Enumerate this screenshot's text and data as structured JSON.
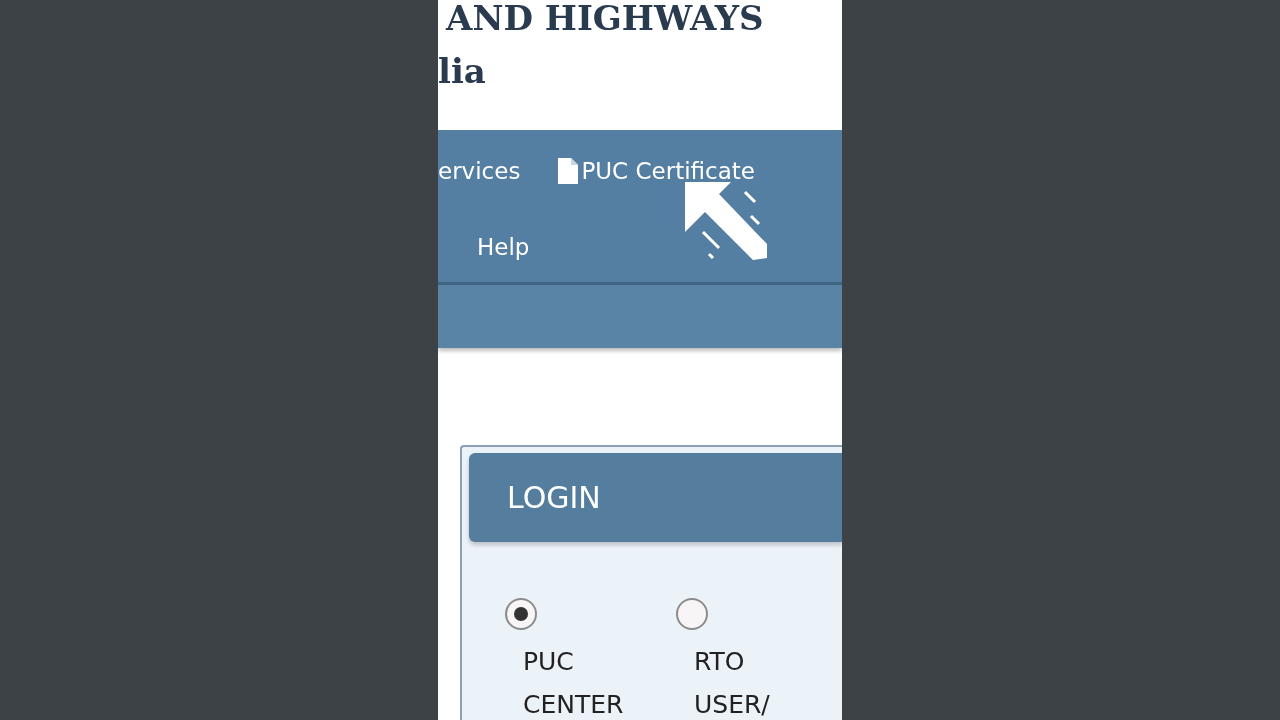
{
  "header": {
    "title_lines": [
      "AND HIGHWAYS",
      "lia"
    ]
  },
  "nav": {
    "rows": [
      [
        {
          "label": "ervices",
          "kind": "plain"
        },
        {
          "label": "PUC Certificate",
          "kind": "file"
        }
      ],
      [
        {
          "label": "Help",
          "kind": "plain"
        }
      ]
    ]
  },
  "login": {
    "title": "LOGIN",
    "options": [
      {
        "label": "PUC CENTER",
        "selected": true
      },
      {
        "label": "RTO USER/",
        "selected": false
      }
    ]
  }
}
